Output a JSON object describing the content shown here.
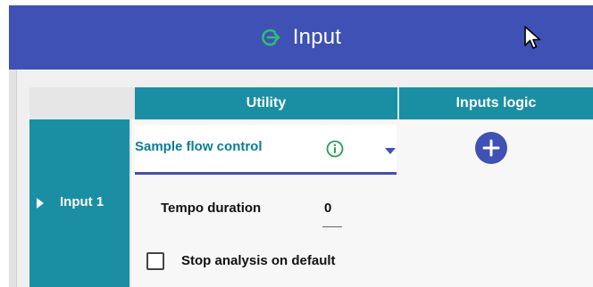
{
  "window": {
    "title": "Input",
    "title_icon": "login-arrow-icon"
  },
  "table": {
    "columns": [
      "Utility",
      "Inputs logic"
    ],
    "rows": [
      {
        "label": "Input 1",
        "utility": {
          "selected": "Sample flow control",
          "fields": {
            "tempo_duration_label": "Tempo duration",
            "tempo_duration_value": "0",
            "stop_analysis_label": "Stop analysis on default",
            "stop_analysis_checked": false
          }
        }
      }
    ]
  },
  "colors": {
    "title_bar": "#3f51b5",
    "header": "#1a8fa3",
    "accent_green": "#2fbf6a",
    "dropdown_text": "#0c7c95"
  }
}
